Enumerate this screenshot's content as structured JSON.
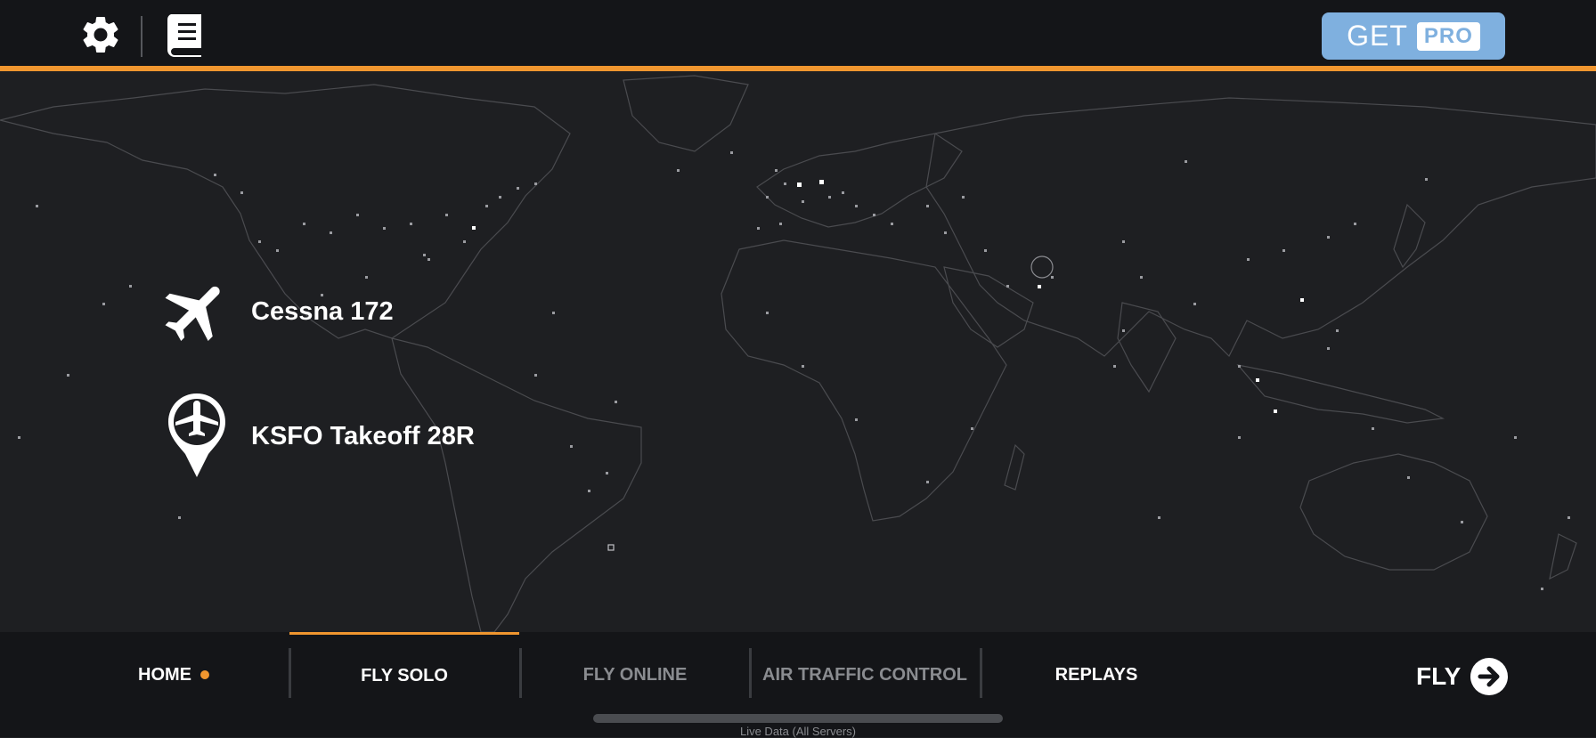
{
  "header": {
    "settings_icon": "gear-icon",
    "manual_icon": "book-icon",
    "get_pro": {
      "get": "GET",
      "pro": "PRO"
    }
  },
  "colors": {
    "accent": "#f0962f",
    "pro_button": "#7fb0df",
    "background": "#1e1f22",
    "bar": "#141518"
  },
  "selection": {
    "aircraft": {
      "icon": "airplane-icon",
      "label": "Cessna 172"
    },
    "airport": {
      "icon": "airport-pin-icon",
      "label": "KSFO Takeoff 28R"
    }
  },
  "nav": {
    "tabs": [
      {
        "label": "HOME",
        "state": "normal",
        "indicator": true
      },
      {
        "label": "FLY SOLO",
        "state": "active"
      },
      {
        "label": "FLY ONLINE",
        "state": "dim"
      },
      {
        "label": "AIR TRAFFIC CONTROL",
        "state": "dim"
      },
      {
        "label": "REPLAYS",
        "state": "normal"
      }
    ],
    "fly_button": {
      "label": "FLY",
      "icon": "arrow-right-circle-icon"
    }
  },
  "footer": {
    "live_label": "Live Data (All Servers)"
  }
}
